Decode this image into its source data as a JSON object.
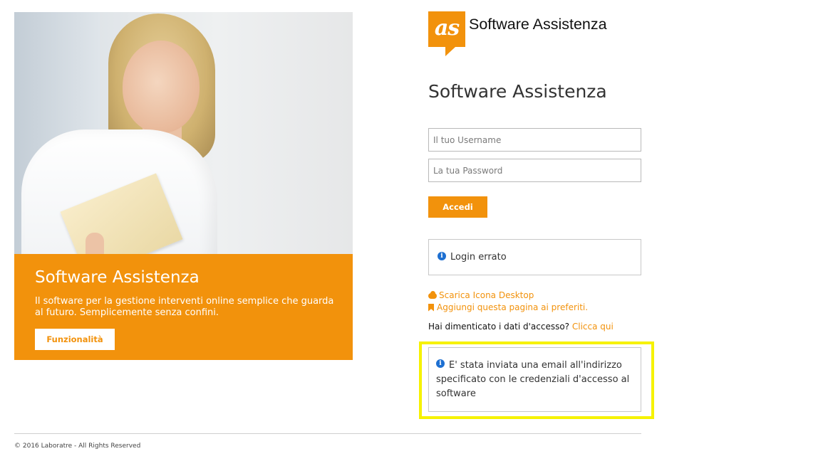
{
  "colors": {
    "accent": "#f2920c",
    "highlight": "#f6f200",
    "info_icon": "#1d6fd1"
  },
  "hero": {
    "title": "Software Assistenza",
    "description": "Il software per la gestione interventi online semplice che guarda al futuro. Semplicemente senza confini.",
    "button_label": "Funzionalità"
  },
  "logo": {
    "letters": "as",
    "name": "Software Assistenza"
  },
  "login": {
    "title": "Software Assistenza",
    "username_placeholder": "Il tuo Username",
    "password_placeholder": "La tua Password",
    "submit_label": "Accedi",
    "error_message": "Login errato",
    "links": {
      "download": "Scarica Icona Desktop",
      "bookmark": "Aggiungi questa pagina ai preferiti."
    },
    "forgot_text": "Hai dimenticato i dati d'accesso?",
    "forgot_link": "Clicca qui",
    "info_message": "E' stata inviata una email all'indirizzo specificato con le credenziali d'accesso al software"
  },
  "footer": {
    "copyright": "© 2016 Laboratre - All Rights Reserved"
  },
  "icons": {
    "info": "info-circle-icon",
    "download": "cloud-download-icon",
    "bookmark": "bookmark-icon"
  }
}
